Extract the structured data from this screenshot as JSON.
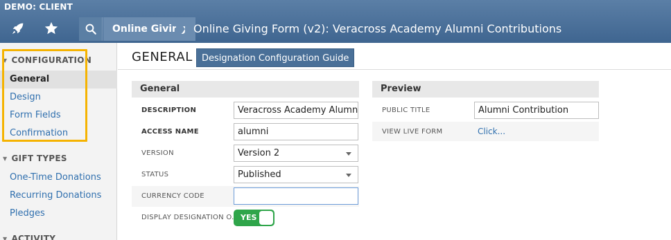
{
  "header": {
    "client": "DEMO: CLIENT",
    "module": "Online Giving",
    "title": "Online Giving Form (v2): Veracross Academy Alumni Contributions"
  },
  "sidebar": {
    "sections": [
      {
        "title": "CONFIGURATION",
        "items": [
          "General",
          "Design",
          "Form Fields",
          "Confirmation"
        ]
      },
      {
        "title": "GIFT TYPES",
        "items": [
          "One-Time Donations",
          "Recurring Donations",
          "Pledges"
        ]
      },
      {
        "title": "ACTIVITY",
        "items": []
      }
    ],
    "active_item": "General"
  },
  "main": {
    "title": "GENERAL",
    "guide_button": "Designation Configuration Guide",
    "general_panel": {
      "title": "General",
      "rows": [
        {
          "label": "DESCRIPTION",
          "value": "Veracross Academy Alumni Contri"
        },
        {
          "label": "ACCESS NAME",
          "value": "alumni"
        },
        {
          "label": "VERSION",
          "value": "Version 2"
        },
        {
          "label": "STATUS",
          "value": "Published"
        },
        {
          "label": "CURRENCY CODE",
          "value": ""
        },
        {
          "label": "DISPLAY DESIGNATION O...",
          "value": "YES"
        }
      ]
    },
    "preview_panel": {
      "title": "Preview",
      "rows": [
        {
          "label": "PUBLIC TITLE",
          "value": "Alumni Contribution"
        },
        {
          "label": "VIEW LIVE FORM",
          "value": "Click..."
        }
      ]
    }
  },
  "colors": {
    "header": "#4a6f98",
    "accent_link": "#2f6fae",
    "highlight": "#f5b301",
    "toggle_on": "#2fa54a"
  },
  "icons": [
    "rocket-icon",
    "star-icon",
    "search-icon",
    "disclosure-triangle-icon",
    "select-arrow-icon"
  ]
}
